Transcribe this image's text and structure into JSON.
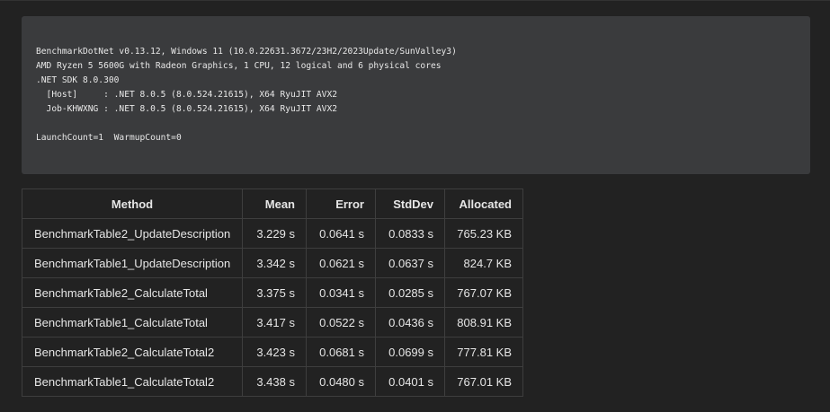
{
  "env_block": {
    "lines": [
      "BenchmarkDotNet v0.13.12, Windows 11 (10.0.22631.3672/23H2/2023Update/SunValley3)",
      "AMD Ryzen 5 5600G with Radeon Graphics, 1 CPU, 12 logical and 6 physical cores",
      ".NET SDK 8.0.300",
      "  [Host]     : .NET 8.0.5 (8.0.524.21615), X64 RyuJIT AVX2",
      "  Job-KHWXNG : .NET 8.0.5 (8.0.524.21615), X64 RyuJIT AVX2",
      "",
      "LaunchCount=1  WarmupCount=0"
    ]
  },
  "table": {
    "headers": {
      "method": "Method",
      "mean": "Mean",
      "error": "Error",
      "stddev": "StdDev",
      "allocated": "Allocated"
    },
    "rows": [
      {
        "method": "BenchmarkTable2_UpdateDescription",
        "mean": "3.229 s",
        "error": "0.0641 s",
        "stddev": "0.0833 s",
        "allocated": "765.23 KB"
      },
      {
        "method": "BenchmarkTable1_UpdateDescription",
        "mean": "3.342 s",
        "error": "0.0621 s",
        "stddev": "0.0637 s",
        "allocated": "824.7 KB"
      },
      {
        "method": "BenchmarkTable2_CalculateTotal",
        "mean": "3.375 s",
        "error": "0.0341 s",
        "stddev": "0.0285 s",
        "allocated": "767.07 KB"
      },
      {
        "method": "BenchmarkTable1_CalculateTotal",
        "mean": "3.417 s",
        "error": "0.0522 s",
        "stddev": "0.0436 s",
        "allocated": "808.91 KB"
      },
      {
        "method": "BenchmarkTable2_CalculateTotal2",
        "mean": "3.423 s",
        "error": "0.0681 s",
        "stddev": "0.0699 s",
        "allocated": "777.81 KB"
      },
      {
        "method": "BenchmarkTable1_CalculateTotal2",
        "mean": "3.438 s",
        "error": "0.0480 s",
        "stddev": "0.0401 s",
        "allocated": "767.01 KB"
      }
    ]
  }
}
